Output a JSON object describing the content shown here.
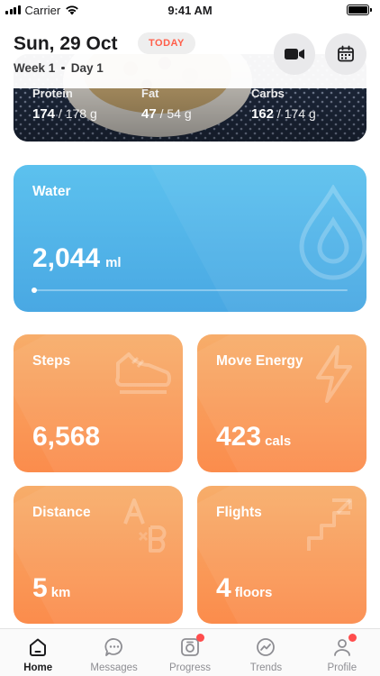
{
  "status_bar": {
    "carrier": "Carrier",
    "time": "9:41 AM"
  },
  "header": {
    "date": "Sun, 29 Oct",
    "today_badge": "TODAY",
    "week": "Week 1",
    "day": "Day 1"
  },
  "macros": {
    "protein": {
      "label": "Protein",
      "value": "174",
      "target": "178 g"
    },
    "fat": {
      "label": "Fat",
      "value": "47",
      "target": "54 g"
    },
    "carbs": {
      "label": "Carbs",
      "value": "162",
      "target": "174 g"
    }
  },
  "water": {
    "title": "Water",
    "value": "2,044",
    "unit": "ml",
    "progress": 0.0
  },
  "steps": {
    "title": "Steps",
    "value": "6,568",
    "unit": ""
  },
  "move_energy": {
    "title": "Move Energy",
    "value": "423",
    "unit": "cals"
  },
  "distance": {
    "title": "Distance",
    "value": "5",
    "unit": "km"
  },
  "flights": {
    "title": "Flights",
    "value": "4",
    "unit": "floors"
  },
  "tabs": [
    {
      "label": "Home",
      "icon": "home-icon",
      "active": true,
      "badge": false
    },
    {
      "label": "Messages",
      "icon": "messages-icon",
      "active": false,
      "badge": false
    },
    {
      "label": "Progress",
      "icon": "progress-camera-icon",
      "active": false,
      "badge": true
    },
    {
      "label": "Trends",
      "icon": "trends-icon",
      "active": false,
      "badge": false
    },
    {
      "label": "Profile",
      "icon": "profile-icon",
      "active": false,
      "badge": true
    }
  ],
  "colors": {
    "today": "#ff5f4a",
    "water": "#4fb1e6",
    "orange": "#fa9a58",
    "badge": "#ff4d4d"
  }
}
